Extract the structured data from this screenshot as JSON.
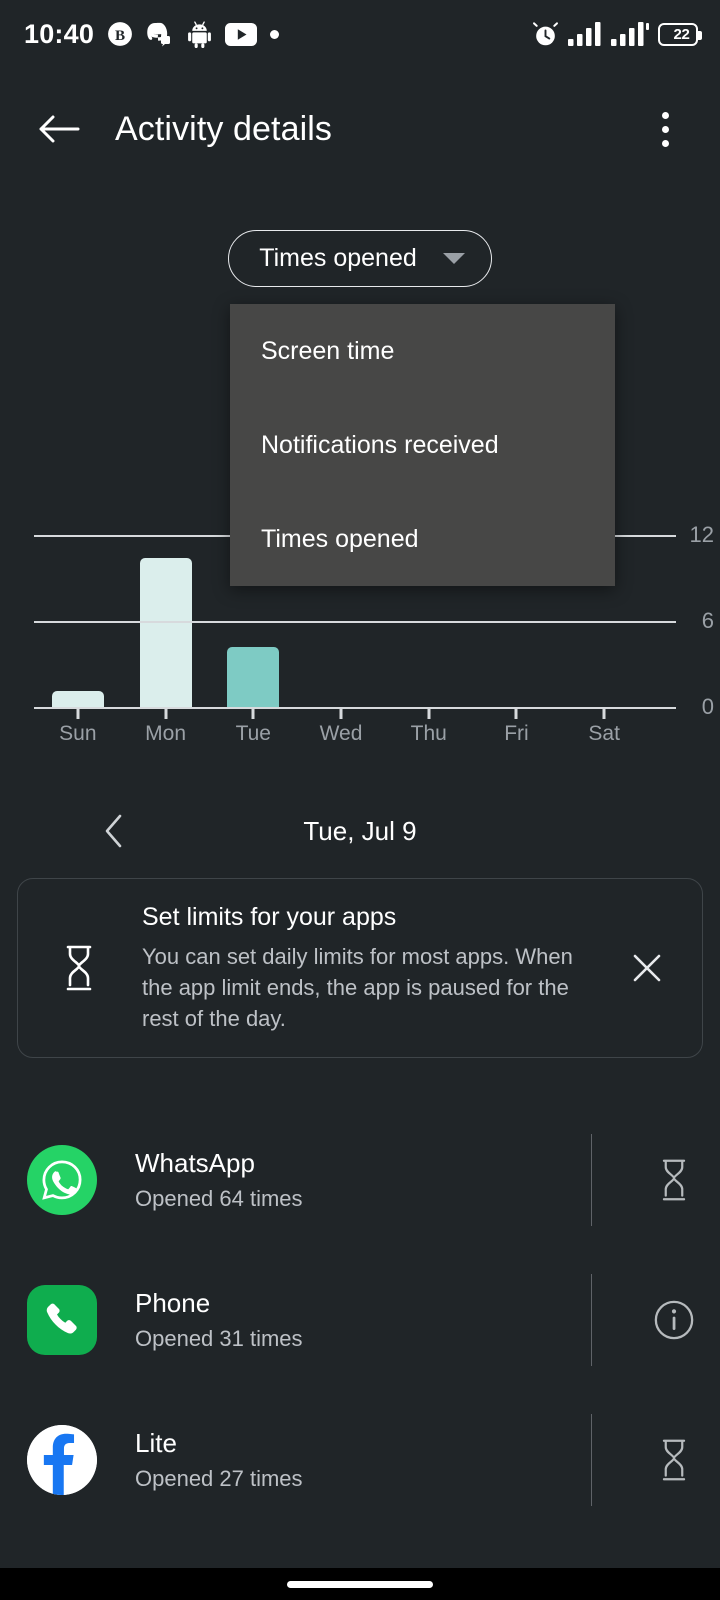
{
  "status_bar": {
    "time": "10:40",
    "left_icons": [
      "bitcoin-icon",
      "discord-icon",
      "android-icon",
      "youtube-icon",
      "dot-icon"
    ],
    "right_icons": [
      "alarm-icon",
      "signal-bars-icon",
      "signal-bars-icon"
    ],
    "battery_percent": "22"
  },
  "app_bar": {
    "title": "Activity details",
    "back_icon": "back-arrow-icon",
    "overflow_icon": "more-vert-icon"
  },
  "metric_chip": {
    "label": "Times opened",
    "caret_icon": "chevron-down-icon"
  },
  "dropdown_menu": {
    "open": true,
    "items": [
      {
        "label": "Screen time"
      },
      {
        "label": "Notifications received"
      },
      {
        "label": "Times opened"
      }
    ],
    "selected": "Times opened"
  },
  "chart_data": {
    "type": "bar",
    "title": "Times opened",
    "categories": [
      "Sun",
      "Mon",
      "Tue",
      "Wed",
      "Thu",
      "Fri",
      "Sat"
    ],
    "values": [
      1.1,
      10.4,
      4.2,
      0,
      0,
      0,
      0
    ],
    "colors": [
      "#dbeeec",
      "#dbeeec",
      "#7ecbc4",
      "#dbeeec",
      "#dbeeec",
      "#dbeeec",
      "#dbeeec"
    ],
    "highlight_index": 2,
    "highlight_color": "#7ecbc4",
    "bar_color": "#dbeeec",
    "xlabel": "",
    "ylabel": "",
    "ylim": [
      0,
      12
    ],
    "yticks": [
      0,
      6,
      12
    ],
    "ytick_labels": [
      "0",
      "6",
      "12"
    ],
    "grid": true,
    "legend": "none"
  },
  "date_nav": {
    "prev_icon": "chevron-left-icon",
    "date": "Tue, Jul 9"
  },
  "info_card": {
    "icon": "hourglass-icon",
    "title": "Set limits for your apps",
    "description": "You can set daily limits for most apps. When the app limit ends, the app is paused for the rest of the day.",
    "close_icon": "close-icon"
  },
  "app_list": {
    "rows": [
      {
        "name": "WhatsApp",
        "subtitle": "Opened 64 times",
        "icon": "whatsapp-icon",
        "icon_color": "#25D366",
        "action_icon": "hourglass-icon"
      },
      {
        "name": "Phone",
        "subtitle": "Opened 31 times",
        "icon": "phone-icon",
        "icon_color": "#0FAD4E",
        "action_icon": "info-icon"
      },
      {
        "name": "Lite",
        "subtitle": "Opened 27 times",
        "icon": "facebook-icon",
        "icon_color": "#1877F2",
        "action_icon": "hourglass-icon"
      }
    ]
  },
  "nav_bar": {
    "gesture_pill": "home-indicator"
  },
  "theme": {
    "background": "#202528",
    "menu_background": "#474746",
    "accent": "#7ecbc4",
    "muted_text": "#9aa0a6"
  }
}
